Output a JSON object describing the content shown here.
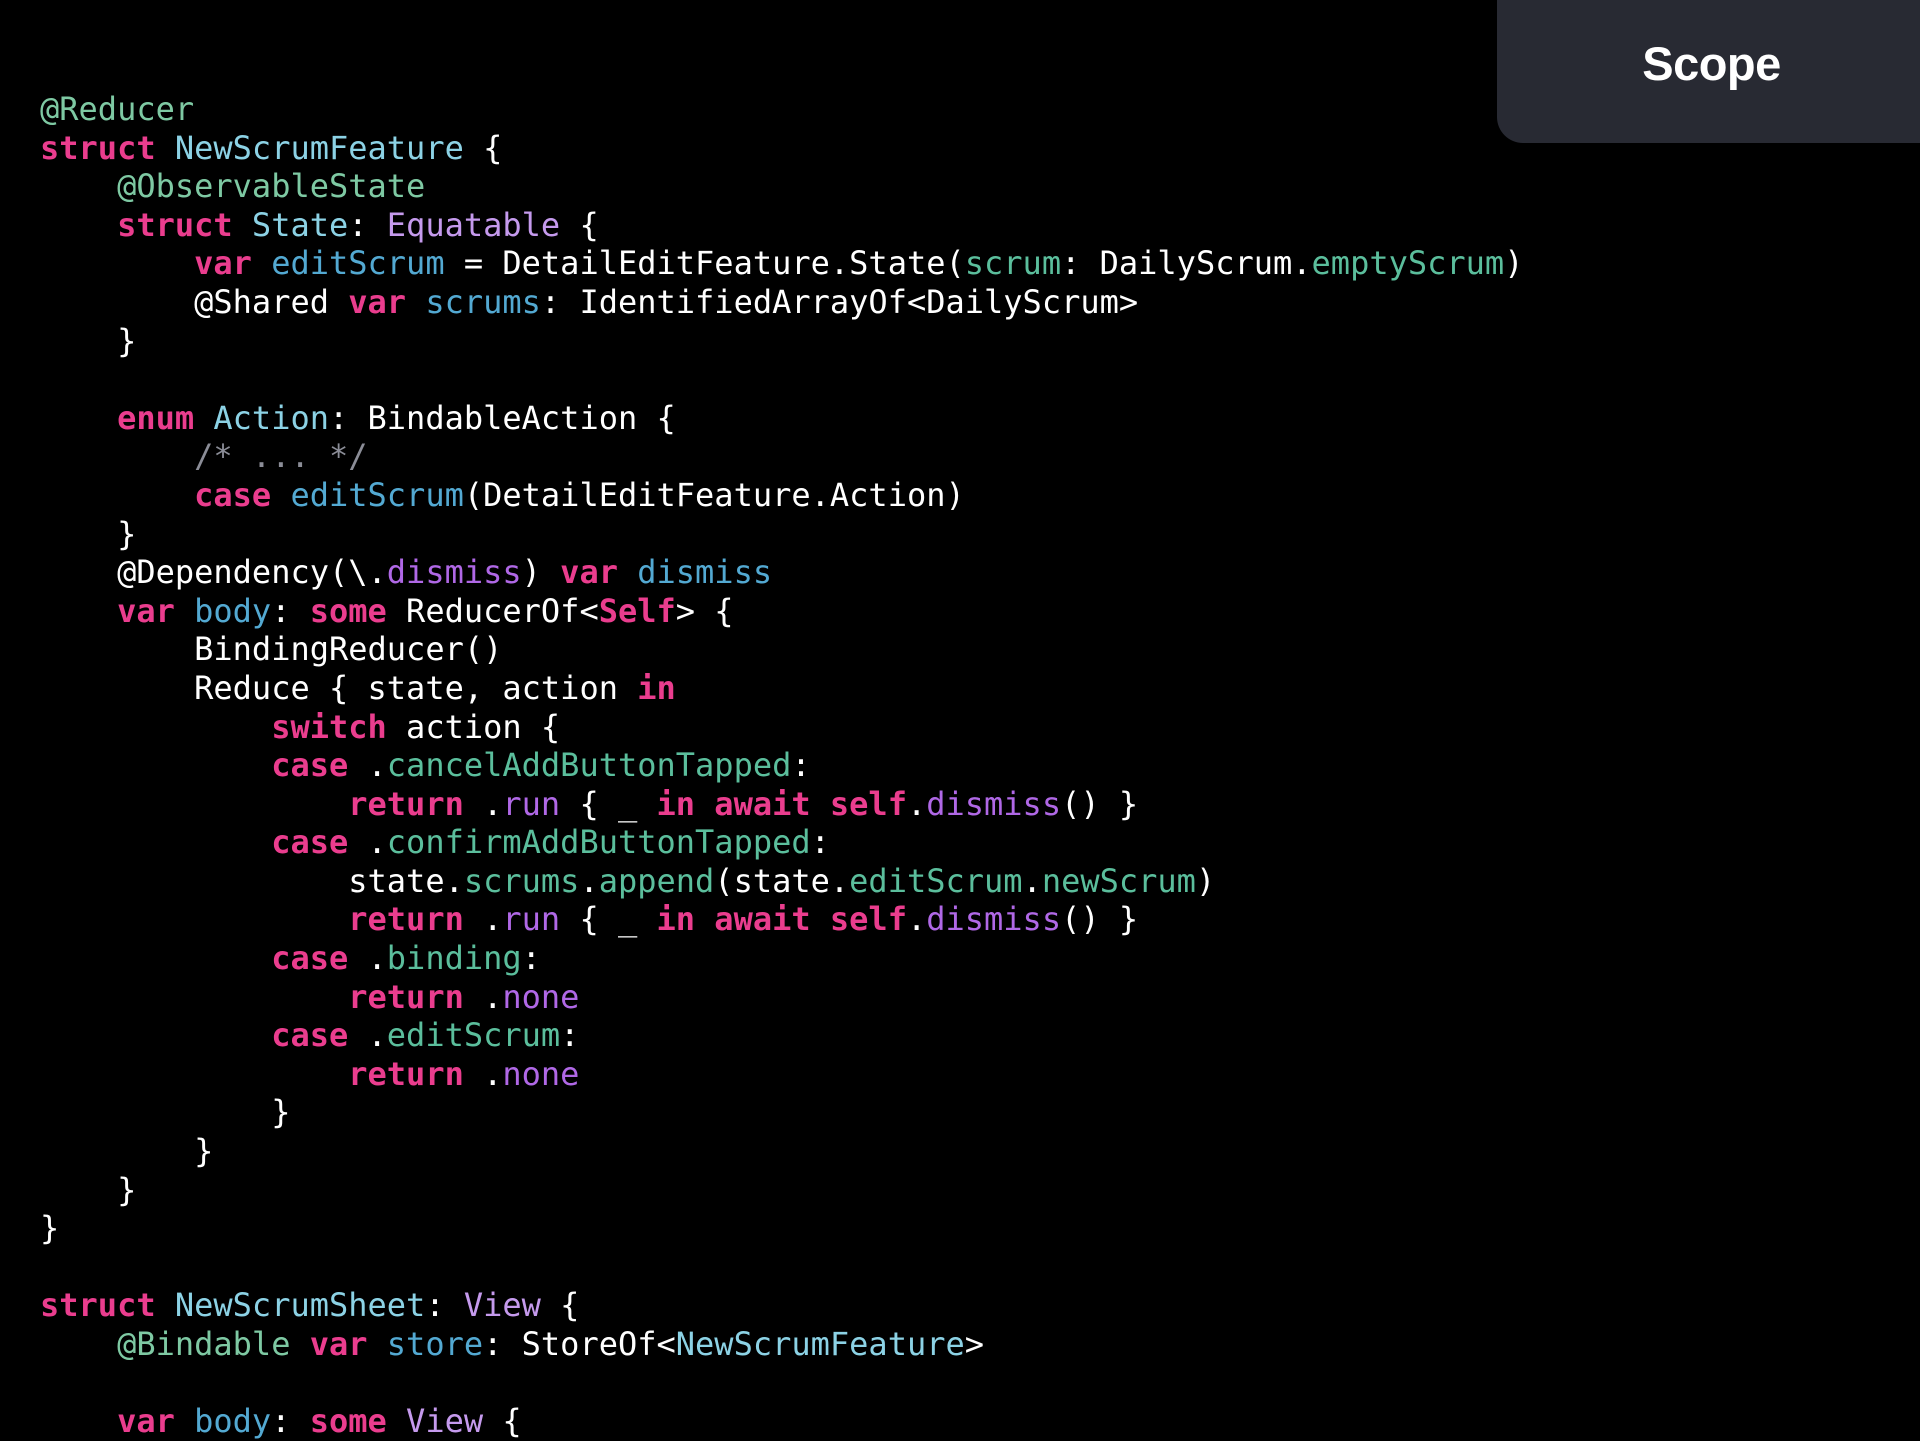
{
  "header": {
    "badge_title": "Scope"
  },
  "code": {
    "language": "swift",
    "lines": [
      [
        [
          "@Reducer",
          "attr"
        ]
      ],
      [
        [
          "struct",
          "kw"
        ],
        [
          " ",
          ""
        ],
        [
          "NewScrumFeature",
          "type"
        ],
        [
          " {",
          ""
        ]
      ],
      [
        [
          "    ",
          ""
        ],
        [
          "@ObservableState",
          "attr"
        ]
      ],
      [
        [
          "    ",
          ""
        ],
        [
          "struct",
          "kw"
        ],
        [
          " ",
          ""
        ],
        [
          "State",
          "type"
        ],
        [
          ": ",
          ""
        ],
        [
          "Equatable",
          "proto"
        ],
        [
          " {",
          ""
        ]
      ],
      [
        [
          "        ",
          ""
        ],
        [
          "var",
          "kw"
        ],
        [
          " ",
          ""
        ],
        [
          "editScrum",
          "ident"
        ],
        [
          " = DetailEditFeature.State(",
          ""
        ],
        [
          "scrum",
          "mem"
        ],
        [
          ": DailyScrum.",
          ""
        ],
        [
          "emptyScrum",
          "mem"
        ],
        [
          ")",
          ""
        ]
      ],
      [
        [
          "        @Shared ",
          ""
        ],
        [
          "var",
          "kw"
        ],
        [
          " ",
          ""
        ],
        [
          "scrums",
          "ident"
        ],
        [
          ": IdentifiedArrayOf<DailyScrum>",
          ""
        ]
      ],
      [
        [
          "    }",
          ""
        ]
      ],
      [
        [
          "",
          ""
        ]
      ],
      [
        [
          "    ",
          ""
        ],
        [
          "enum",
          "kw"
        ],
        [
          " ",
          ""
        ],
        [
          "Action",
          "type"
        ],
        [
          ": BindableAction {",
          ""
        ]
      ],
      [
        [
          "        ",
          ""
        ],
        [
          "/* ... */",
          "cmt"
        ]
      ],
      [
        [
          "        ",
          ""
        ],
        [
          "case",
          "kw"
        ],
        [
          " ",
          ""
        ],
        [
          "editScrum",
          "ident"
        ],
        [
          "(DetailEditFeature.Action)",
          ""
        ]
      ],
      [
        [
          "    }",
          ""
        ]
      ],
      [
        [
          "    @Dependency(\\.",
          ""
        ],
        [
          "dismiss",
          "meth"
        ],
        [
          ") ",
          ""
        ],
        [
          "var",
          "kw"
        ],
        [
          " ",
          ""
        ],
        [
          "dismiss",
          "ident"
        ]
      ],
      [
        [
          "    ",
          ""
        ],
        [
          "var",
          "kw"
        ],
        [
          " ",
          ""
        ],
        [
          "body",
          "ident"
        ],
        [
          ": ",
          ""
        ],
        [
          "some",
          "kw"
        ],
        [
          " ReducerOf<",
          ""
        ],
        [
          "Self",
          "kw"
        ],
        [
          "> {",
          ""
        ]
      ],
      [
        [
          "        BindingReducer()",
          ""
        ]
      ],
      [
        [
          "        Reduce { state, action ",
          ""
        ],
        [
          "in",
          "kw"
        ]
      ],
      [
        [
          "            ",
          ""
        ],
        [
          "switch",
          "kw"
        ],
        [
          " action {",
          ""
        ]
      ],
      [
        [
          "            ",
          ""
        ],
        [
          "case",
          "kw"
        ],
        [
          " .",
          ""
        ],
        [
          "cancelAddButtonTapped",
          "mem"
        ],
        [
          ":",
          ""
        ]
      ],
      [
        [
          "                ",
          ""
        ],
        [
          "return",
          "kw"
        ],
        [
          " .",
          ""
        ],
        [
          "run",
          "meth"
        ],
        [
          " { _ ",
          ""
        ],
        [
          "in",
          "kw"
        ],
        [
          " ",
          ""
        ],
        [
          "await",
          "kw"
        ],
        [
          " ",
          ""
        ],
        [
          "self",
          "kw"
        ],
        [
          ".",
          ""
        ],
        [
          "dismiss",
          "meth"
        ],
        [
          "() }",
          ""
        ]
      ],
      [
        [
          "            ",
          ""
        ],
        [
          "case",
          "kw"
        ],
        [
          " .",
          ""
        ],
        [
          "confirmAddButtonTapped",
          "mem"
        ],
        [
          ":",
          ""
        ]
      ],
      [
        [
          "                state.",
          ""
        ],
        [
          "scrums",
          "mem"
        ],
        [
          ".",
          ""
        ],
        [
          "append",
          "mem"
        ],
        [
          "(state.",
          ""
        ],
        [
          "editScrum",
          "mem"
        ],
        [
          ".",
          ""
        ],
        [
          "newScrum",
          "mem"
        ],
        [
          ")",
          ""
        ]
      ],
      [
        [
          "                ",
          ""
        ],
        [
          "return",
          "kw"
        ],
        [
          " .",
          ""
        ],
        [
          "run",
          "meth"
        ],
        [
          " { _ ",
          ""
        ],
        [
          "in",
          "kw"
        ],
        [
          " ",
          ""
        ],
        [
          "await",
          "kw"
        ],
        [
          " ",
          ""
        ],
        [
          "self",
          "kw"
        ],
        [
          ".",
          ""
        ],
        [
          "dismiss",
          "meth"
        ],
        [
          "() }",
          ""
        ]
      ],
      [
        [
          "            ",
          ""
        ],
        [
          "case",
          "kw"
        ],
        [
          " .",
          ""
        ],
        [
          "binding",
          "mem"
        ],
        [
          ":",
          ""
        ]
      ],
      [
        [
          "                ",
          ""
        ],
        [
          "return",
          "kw"
        ],
        [
          " .",
          ""
        ],
        [
          "none",
          "meth"
        ]
      ],
      [
        [
          "            ",
          ""
        ],
        [
          "case",
          "kw"
        ],
        [
          " .",
          ""
        ],
        [
          "editScrum",
          "mem"
        ],
        [
          ":",
          ""
        ]
      ],
      [
        [
          "                ",
          ""
        ],
        [
          "return",
          "kw"
        ],
        [
          " .",
          ""
        ],
        [
          "none",
          "meth"
        ]
      ],
      [
        [
          "            }",
          ""
        ]
      ],
      [
        [
          "        }",
          ""
        ]
      ],
      [
        [
          "    }",
          ""
        ]
      ],
      [
        [
          "}",
          ""
        ]
      ],
      [
        [
          "",
          ""
        ]
      ],
      [
        [
          "struct",
          "kw"
        ],
        [
          " ",
          ""
        ],
        [
          "NewScrumSheet",
          "type"
        ],
        [
          ": ",
          ""
        ],
        [
          "View",
          "proto"
        ],
        [
          " {",
          ""
        ]
      ],
      [
        [
          "    ",
          ""
        ],
        [
          "@Bindable",
          "attr"
        ],
        [
          " ",
          ""
        ],
        [
          "var",
          "kw"
        ],
        [
          " ",
          ""
        ],
        [
          "store",
          "ident"
        ],
        [
          ": StoreOf<",
          ""
        ],
        [
          "NewScrumFeature",
          "type"
        ],
        [
          ">",
          ""
        ]
      ],
      [
        [
          "",
          ""
        ]
      ],
      [
        [
          "    ",
          ""
        ],
        [
          "var",
          "kw"
        ],
        [
          " ",
          ""
        ],
        [
          "body",
          "ident"
        ],
        [
          ": ",
          ""
        ],
        [
          "some",
          "kw"
        ],
        [
          " ",
          ""
        ],
        [
          "View",
          "proto"
        ],
        [
          " {",
          ""
        ]
      ]
    ]
  }
}
